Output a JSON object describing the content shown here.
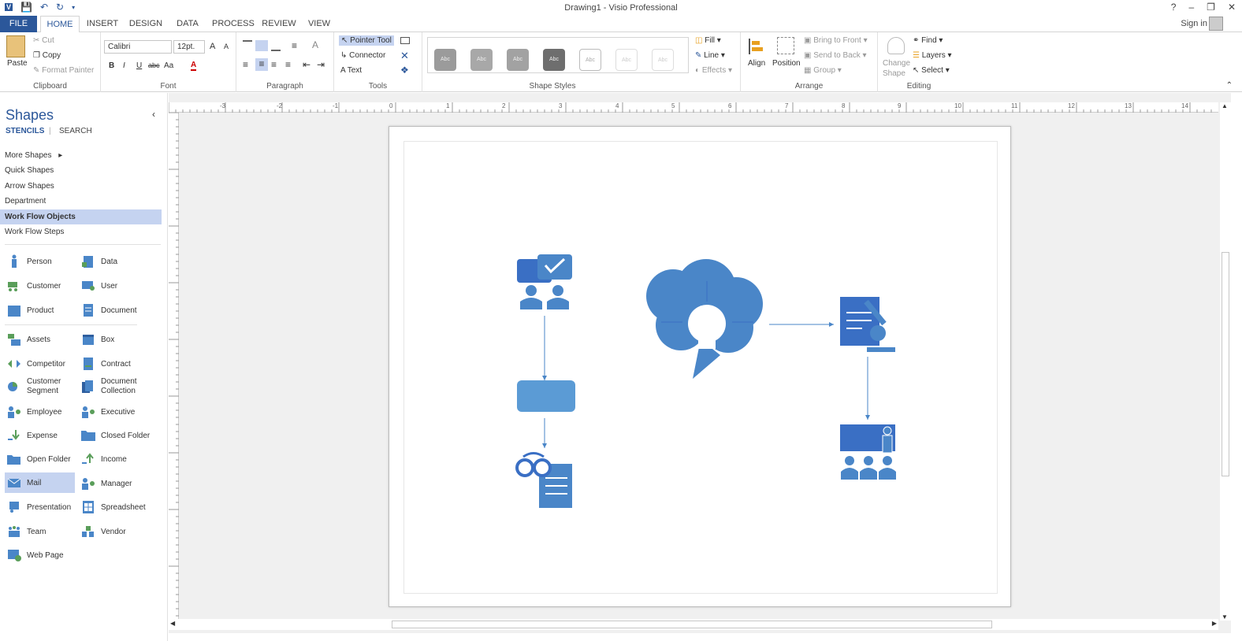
{
  "window": {
    "title": "Drawing1 - Visio Professional",
    "controls": [
      "?",
      "–",
      "❐",
      "✕"
    ]
  },
  "tabs": [
    {
      "label": "FILE"
    },
    {
      "label": "HOME"
    },
    {
      "label": "INSERT"
    },
    {
      "label": "DESIGN"
    },
    {
      "label": "DATA"
    },
    {
      "label": "PROCESS"
    },
    {
      "label": "REVIEW"
    },
    {
      "label": "VIEW"
    }
  ],
  "signin": "Sign in",
  "ribbon": {
    "clipboard": {
      "label": "Clipboard",
      "paste": "Paste",
      "cut": "Cut",
      "copy": "Copy",
      "format_painter": "Format Painter"
    },
    "font": {
      "label": "Font",
      "font_name": "Calibri",
      "font_size": "12pt.",
      "bold": "B",
      "italic": "I",
      "underline": "U",
      "strike": "abc",
      "case": "Aa",
      "grow": "A",
      "shrink": "A",
      "color": "A"
    },
    "paragraph": {
      "label": "Paragraph"
    },
    "tools": {
      "label": "Tools",
      "pointer": "Pointer Tool",
      "connector": "Connector",
      "text": "Text"
    },
    "shape_styles": {
      "label": "Shape Styles",
      "sample": "Abc"
    },
    "fill_line": {
      "fill": "Fill",
      "line": "Line",
      "effects": "Effects"
    },
    "arrange": {
      "label": "Arrange",
      "align": "Align",
      "position": "Position",
      "bring_front": "Bring to Front",
      "send_back": "Send to Back",
      "group": "Group"
    },
    "editing": {
      "label": "Editing",
      "change_shape_1": "Change",
      "change_shape_2": "Shape",
      "find": "Find",
      "layers": "Layers",
      "select": "Select"
    }
  },
  "shapes_pane": {
    "title": "Shapes",
    "stencils": "STENCILS",
    "search": "SEARCH",
    "nav": [
      {
        "label": "More Shapes"
      },
      {
        "label": "Quick Shapes"
      },
      {
        "label": "Arrow Shapes"
      },
      {
        "label": "Department"
      },
      {
        "label": "Work Flow Objects"
      },
      {
        "label": "Work Flow Steps"
      }
    ],
    "items_left": [
      {
        "label": "Person"
      },
      {
        "label": "Customer"
      },
      {
        "label": "Product"
      },
      {
        "label": "Assets"
      },
      {
        "label": "Competitor"
      },
      {
        "label": "Customer Segment"
      },
      {
        "label": "Employee"
      },
      {
        "label": "Expense"
      },
      {
        "label": "Open Folder"
      },
      {
        "label": "Mail"
      },
      {
        "label": "Presentation"
      },
      {
        "label": "Team"
      },
      {
        "label": "Web Page"
      }
    ],
    "items_right": [
      {
        "label": "Data"
      },
      {
        "label": "User"
      },
      {
        "label": "Document"
      },
      {
        "label": "Box"
      },
      {
        "label": "Contract"
      },
      {
        "label": "Document Collection"
      },
      {
        "label": "Executive"
      },
      {
        "label": "Closed Folder"
      },
      {
        "label": "Income"
      },
      {
        "label": "Manager"
      },
      {
        "label": "Spreadsheet"
      },
      {
        "label": "Vendor"
      }
    ]
  },
  "rulers": {
    "horizontal": [
      "-3",
      "-2",
      "-1",
      "0",
      "1",
      "2",
      "3",
      "4",
      "5",
      "6",
      "7",
      "8",
      "9",
      "10",
      "11",
      "12",
      "13",
      "14"
    ]
  },
  "colors": {
    "accent": "#2b579a",
    "shape_blue": "#4a86c8",
    "shape_dark": "#3a6fc4",
    "selection": "#c5d3f0"
  }
}
